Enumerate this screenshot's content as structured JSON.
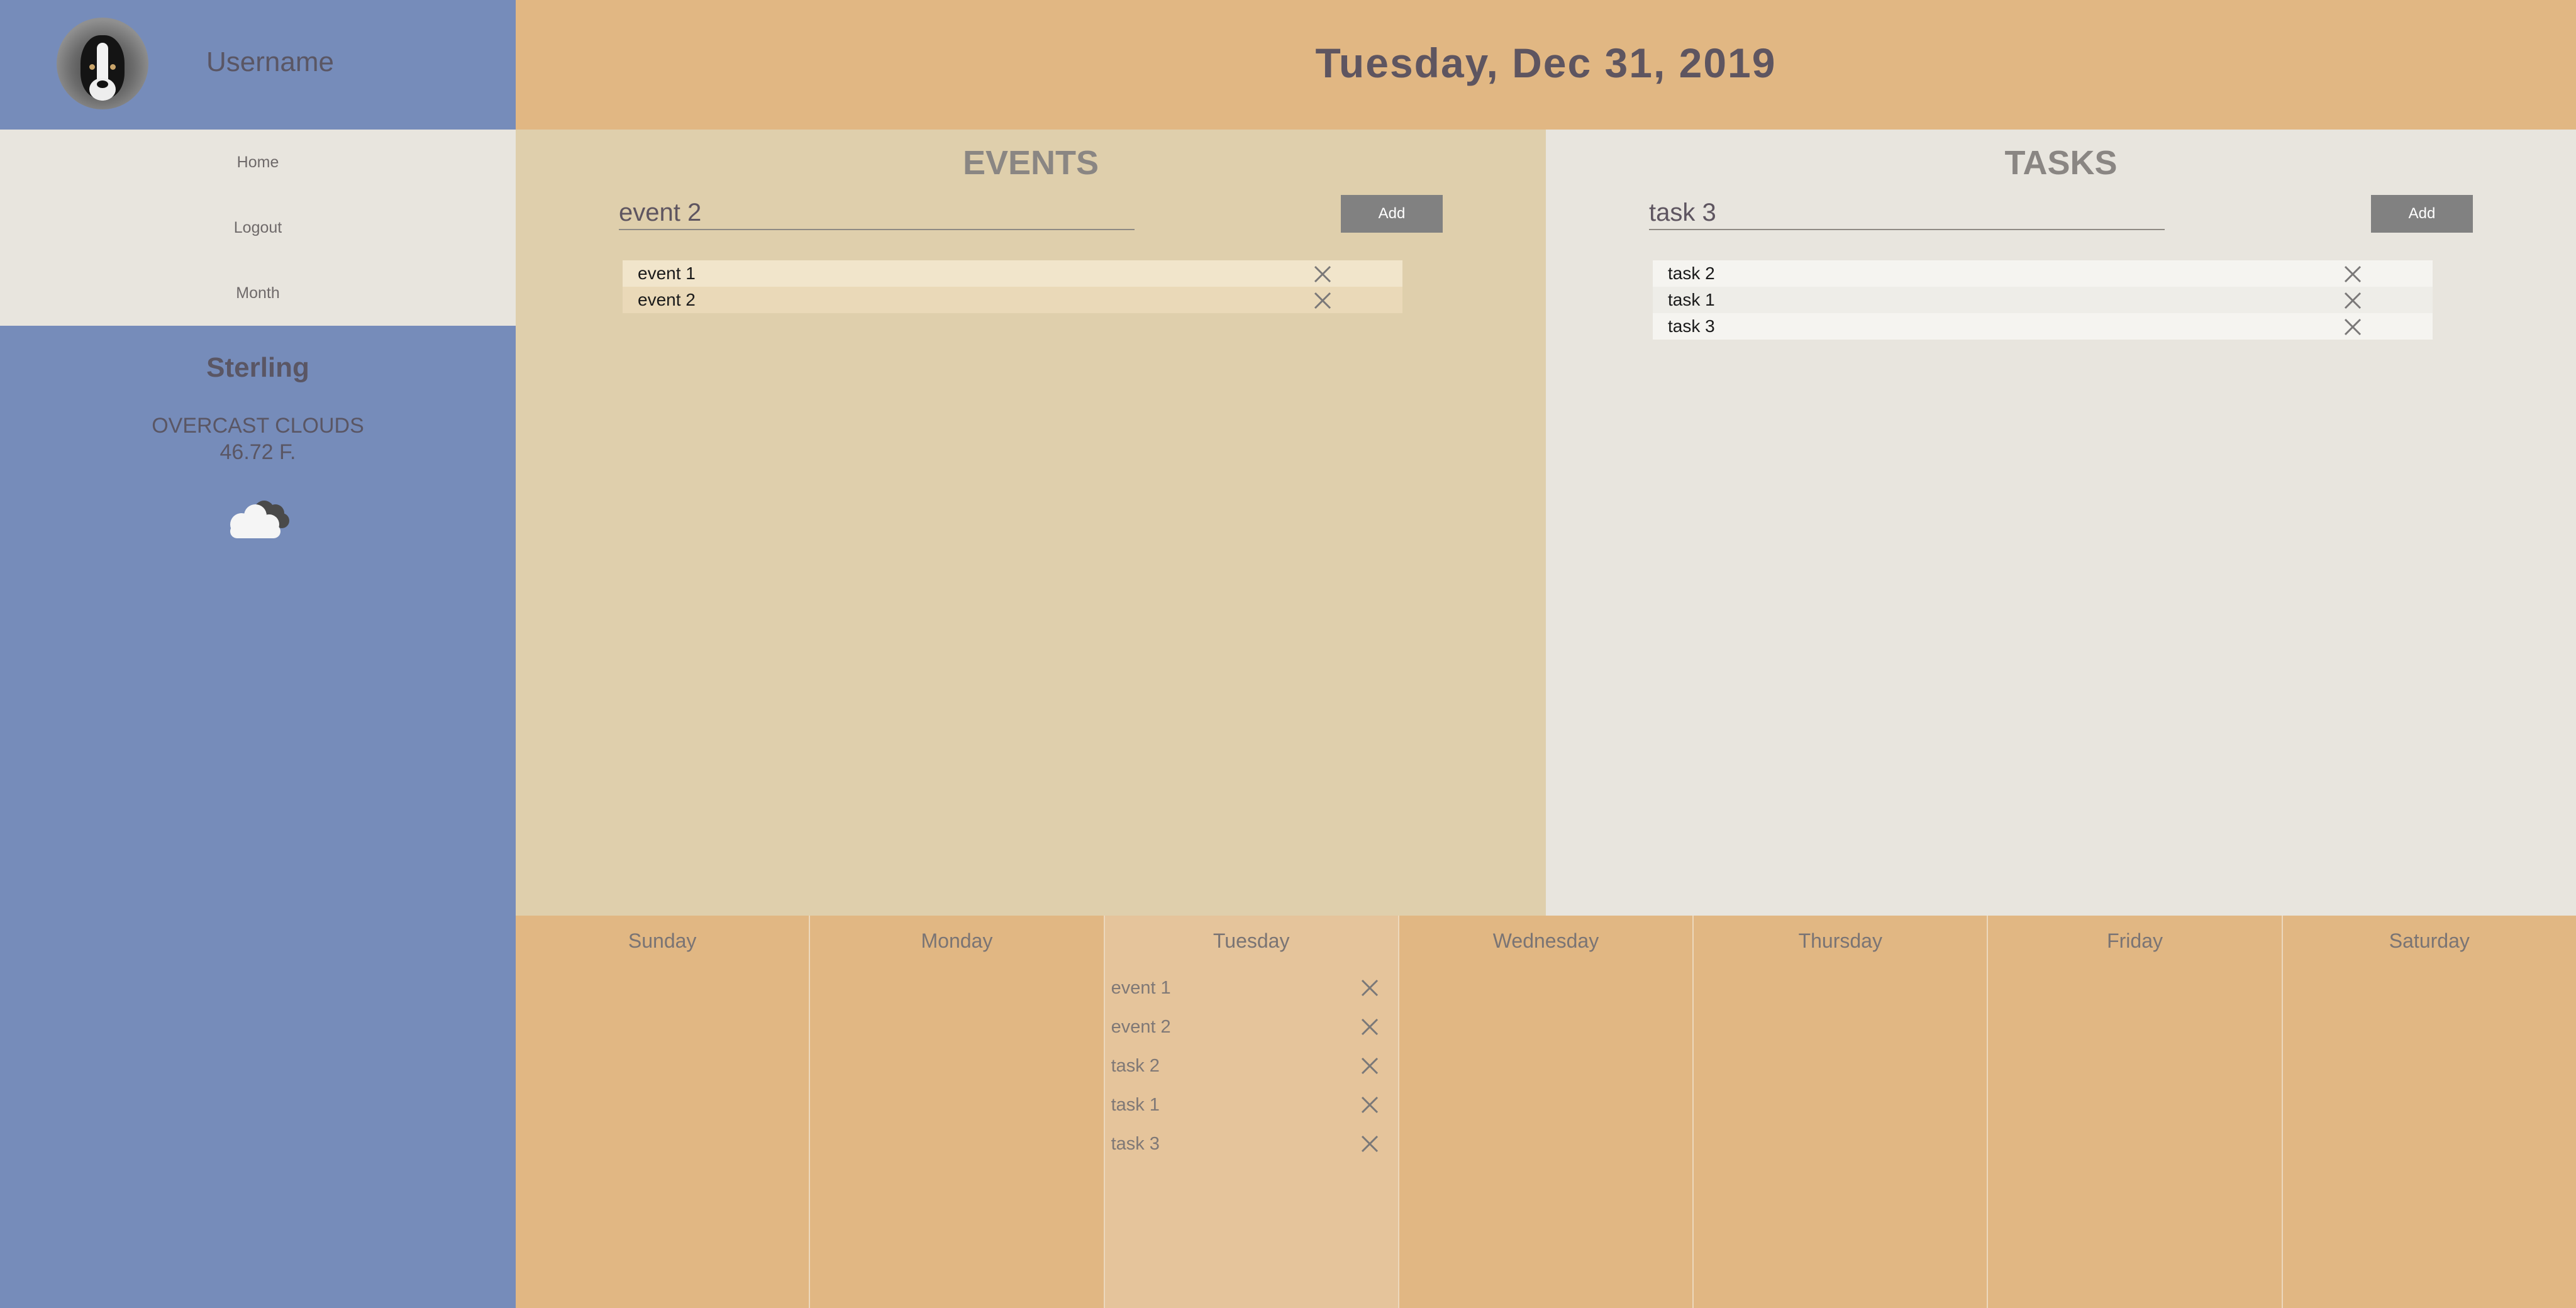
{
  "sidebar": {
    "username": "Username",
    "nav": [
      "Home",
      "Logout",
      "Month"
    ],
    "weather": {
      "city": "Sterling",
      "description": "OVERCAST CLOUDS",
      "temperature": "46.72 F.",
      "icon": "overcast-cloud-icon"
    }
  },
  "header": {
    "date": "Tuesday, Dec 31, 2019"
  },
  "events": {
    "title": "EVENTS",
    "input_value": "event 2",
    "add_label": "Add",
    "items": [
      "event 1",
      "event 2"
    ]
  },
  "tasks": {
    "title": "TASKS",
    "input_value": "task 3",
    "add_label": "Add",
    "items": [
      "task 2",
      "task 1",
      "task 3"
    ]
  },
  "week": {
    "days": [
      "Sunday",
      "Monday",
      "Tuesday",
      "Wednesday",
      "Thursday",
      "Friday",
      "Saturday"
    ],
    "current_day": "Tuesday",
    "current_day_items": [
      "event 1",
      "event 2",
      "task 2",
      "task 1",
      "task 3"
    ]
  },
  "colors": {
    "sidebar": "#768cba",
    "header": "#e1b783",
    "events_panel": "#dfcfac",
    "tasks_panel": "#e8e5de",
    "add_button": "#818181",
    "current_day": "#e5c49b"
  }
}
